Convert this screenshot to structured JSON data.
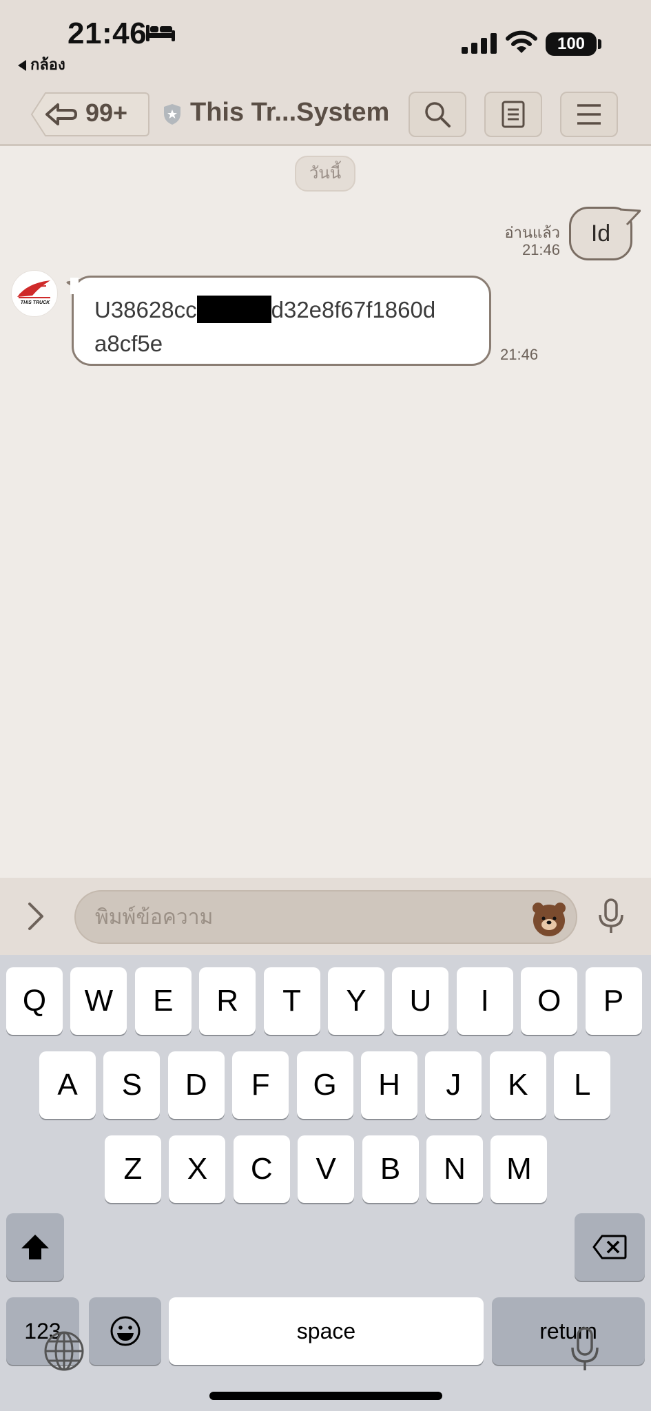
{
  "status_bar": {
    "time": "21:46",
    "back_app_label": "กล้อง",
    "battery": "100"
  },
  "header": {
    "back_count": "99+",
    "title": "This Tr...System"
  },
  "chat": {
    "date_label": "วันนี้",
    "outgoing": {
      "text": "Id",
      "read_label": "อ่านแล้ว",
      "time": "21:46"
    },
    "incoming": {
      "sender_avatar_text": "THIS TRUCK",
      "line1_before": "U38628cc",
      "line1_after": "d32e8f67f1860d",
      "line2": "a8cf5e",
      "time": "21:46"
    }
  },
  "input": {
    "placeholder": "พิมพ์ข้อความ"
  },
  "keyboard": {
    "row1": [
      "Q",
      "W",
      "E",
      "R",
      "T",
      "Y",
      "U",
      "I",
      "O",
      "P"
    ],
    "row2": [
      "A",
      "S",
      "D",
      "F",
      "G",
      "H",
      "J",
      "K",
      "L"
    ],
    "row3": [
      "Z",
      "X",
      "C",
      "V",
      "B",
      "N",
      "M"
    ],
    "numbers_label": "123",
    "space_label": "space",
    "return_label": "return"
  },
  "colors": {
    "background": "#efebe7",
    "header_bg": "#e4ddd7",
    "bubble_border": "#8a7d73",
    "keyboard_bg": "#d1d3d9"
  }
}
